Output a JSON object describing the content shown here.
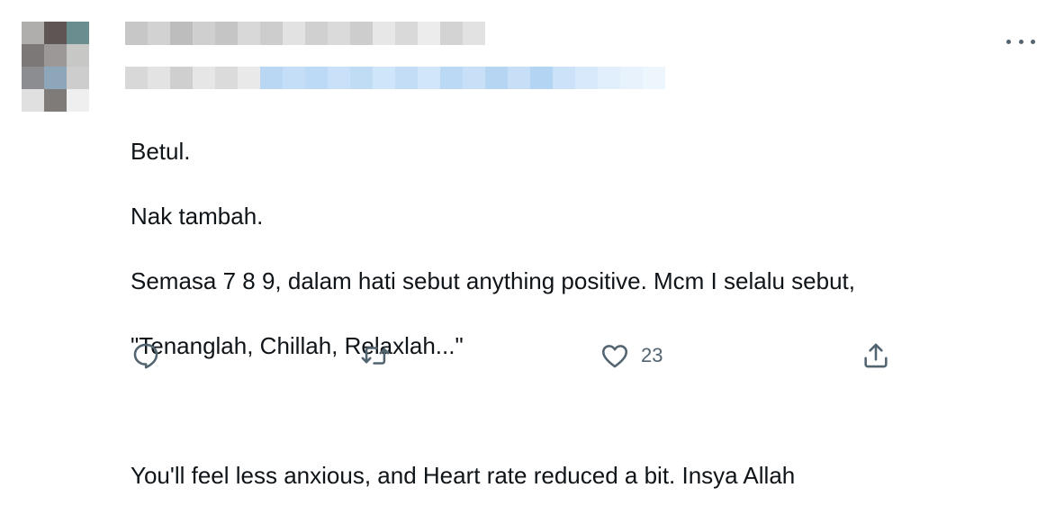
{
  "tweet": {
    "author": {
      "avatar_colors": [
        "#b0aeac",
        "#5e5554",
        "#6a8d8f",
        "#7b7877",
        "#9b9897",
        "#c7c7c6",
        "#8b8d90",
        "#8ea6b9",
        "#cdcdce",
        "#e0e0e0",
        "#7f7b79",
        "#efefef"
      ],
      "name_colors": [
        "#c7c7c7",
        "#d2d2d2",
        "#bdbdbd",
        "#cfcfcf",
        "#c5c5c5",
        "#d8d8d8",
        "#cdcdcd",
        "#e2e2e2",
        "#d0d0d0",
        "#dadada",
        "#cdcdcd",
        "#e7e7e7",
        "#d9d9d9",
        "#ececec",
        "#d3d3d3",
        "#e2e2e2"
      ],
      "handle_colors": [
        "#d8d8d8",
        "#e3e3e3",
        "#cfcfcf",
        "#e6e6e6",
        "#dbdbdb",
        "#e9e9e9",
        "#b9d6f3",
        "#c5def7",
        "#bcd9f5",
        "#c9e1f8",
        "#c0dcf5",
        "#cfe5f9",
        "#c3ddf6",
        "#d1e6fa",
        "#bbd8f4",
        "#c8e0f7",
        "#b6d5f3",
        "#c6dff7",
        "#b3d4f2",
        "#cbe2f8",
        "#d7e9fa",
        "#e1eefb",
        "#e8f2fc",
        "#eef6fd"
      ]
    },
    "text": {
      "line1": "Betul.",
      "line2": "Nak tambah.",
      "line3": "Semasa 7 8 9, dalam hati sebut anything positive. Mcm I selalu sebut,",
      "line4": "\"Tenanglah, Chillah, Relaxlah...\"",
      "line5": "",
      "line6": "You'll feel less anxious, and Heart rate reduced a bit. Insya Allah"
    },
    "actions": {
      "reply_icon": "reply-icon",
      "retweet_icon": "retweet-icon",
      "like_icon": "heart-icon",
      "like_count": "23",
      "share_icon": "share-icon",
      "icon_color": "#536471"
    },
    "more_icon": "more-icon"
  }
}
